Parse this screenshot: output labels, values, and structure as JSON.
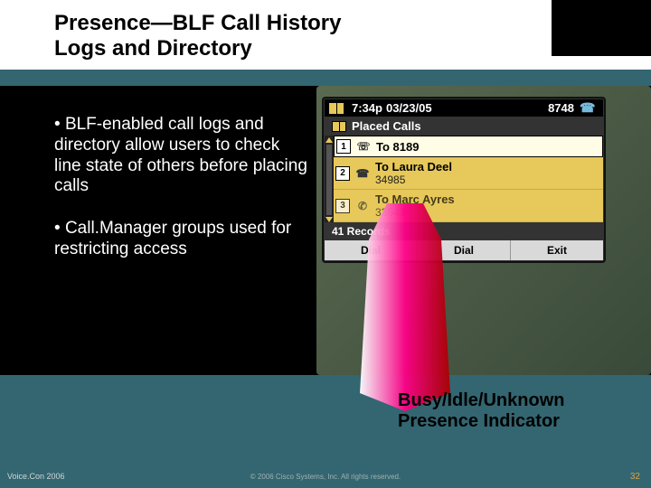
{
  "header": {
    "title_line1": "Presence—BLF Call History",
    "title_line2": "Logs and Directory"
  },
  "bullets": [
    "BLF-enabled call logs and directory allow users to check line state of others before placing calls",
    "Call.Manager groups used for restricting access"
  ],
  "phone": {
    "time": "7:34p",
    "date": "03/23/05",
    "extension": "8748",
    "screen_title": "Placed Calls",
    "rows": [
      {
        "index": "1",
        "label": "To 8189",
        "sub": ""
      },
      {
        "index": "2",
        "label": "To Laura Deel",
        "sub": "34985"
      },
      {
        "index": "3",
        "label": "To Marc Ayres",
        "sub": "33543"
      }
    ],
    "records_label": "41 Records",
    "softkeys": [
      "Dial",
      "Dial",
      "Exit"
    ]
  },
  "caption_line1": "Busy/Idle/Unknown",
  "caption_line2": "Presence Indicator",
  "footer": {
    "left": "Voice.Con 2006",
    "center": "© 2006 Cisco Systems, Inc. All rights reserved.",
    "right": "32"
  }
}
